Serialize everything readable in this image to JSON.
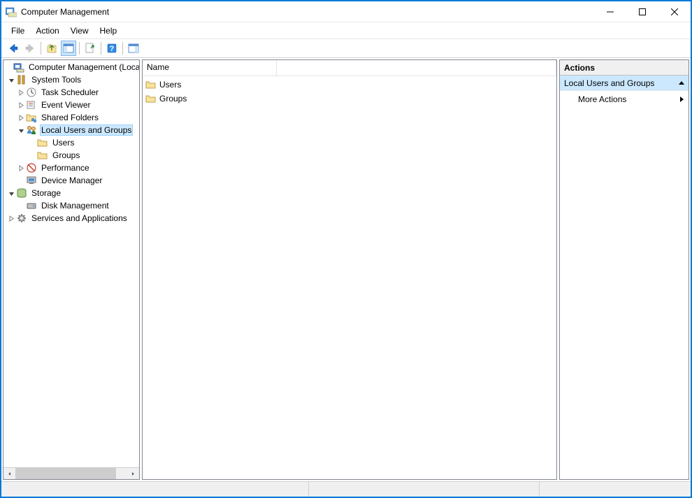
{
  "window": {
    "title": "Computer Management"
  },
  "menu": {
    "file": "File",
    "action": "Action",
    "view": "View",
    "help": "Help"
  },
  "tree": {
    "root": "Computer Management (Local",
    "system_tools": "System Tools",
    "task_scheduler": "Task Scheduler",
    "event_viewer": "Event Viewer",
    "shared_folders": "Shared Folders",
    "local_users_groups": "Local Users and Groups",
    "users": "Users",
    "groups": "Groups",
    "performance": "Performance",
    "device_manager": "Device Manager",
    "storage": "Storage",
    "disk_management": "Disk Management",
    "services_apps": "Services and Applications"
  },
  "list": {
    "header_name": "Name",
    "items": [
      {
        "label": "Users"
      },
      {
        "label": "Groups"
      }
    ]
  },
  "actions": {
    "title": "Actions",
    "section": "Local Users and Groups",
    "more": "More Actions"
  }
}
